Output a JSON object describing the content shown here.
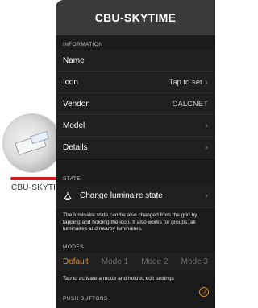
{
  "background": {
    "device_label": "CBU-SKYTI"
  },
  "panel": {
    "title": "CBU-SKYTIME",
    "sections": {
      "information": "INFORMATION",
      "state": "STATE",
      "modes": "MODES",
      "push_buttons": "PUSH BUTTONS"
    },
    "info_rows": [
      {
        "label": "Name",
        "value": ""
      },
      {
        "label": "Icon",
        "value": "Tap to set"
      },
      {
        "label": "Vendor",
        "value": "DALCNET"
      },
      {
        "label": "Model",
        "value": ""
      },
      {
        "label": "Details",
        "value": ""
      }
    ],
    "state": {
      "label": "Change luminaire state",
      "description": "The luminaire state can be also changed from the grid by tapping and holding the icon. It also works for groups, all luminaires and nearby luminaires."
    },
    "modes": {
      "items": [
        "Default",
        "Mode 1",
        "Mode 2",
        "Mode 3"
      ],
      "active": "Default",
      "hint": "Tap to activate a mode and hold to edit settings"
    },
    "help": "?"
  },
  "colors": {
    "accent": "#e38a1b",
    "red_bar": "#d71920",
    "panel_bg": "#1b1b1b",
    "title_bg": "#3a3a3a"
  }
}
